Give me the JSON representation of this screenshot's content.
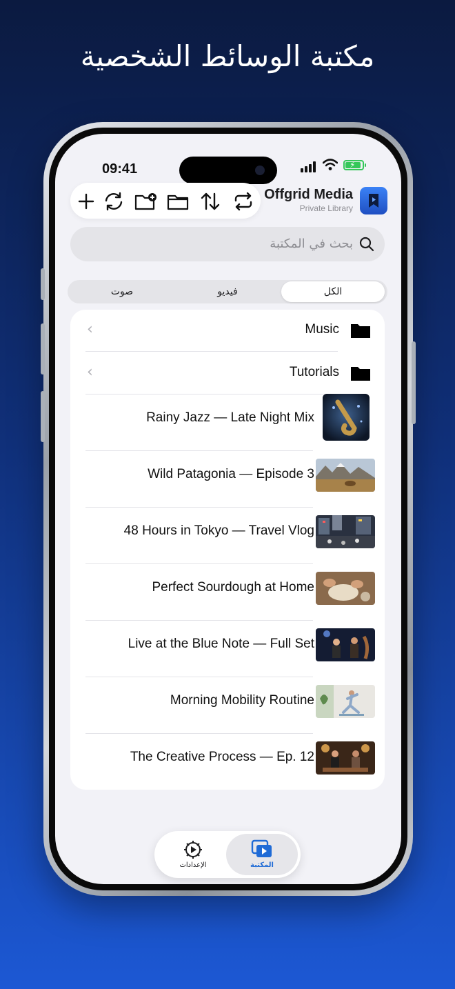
{
  "headline": "مكتبة الوسائط الشخصية",
  "status_bar": {
    "time": "09:41",
    "signal_icon": "signal-icon",
    "wifi_icon": "wifi-icon",
    "battery_icon": "battery-charging-icon"
  },
  "app": {
    "title": "Offgrid Media",
    "subtitle": "Private Library",
    "logo_icon": "bookmark-play-icon"
  },
  "toolbar": {
    "buttons": [
      {
        "icon": "plus-icon"
      },
      {
        "icon": "sync-icon"
      },
      {
        "icon": "new-folder-icon"
      },
      {
        "icon": "folder-icon"
      },
      {
        "icon": "sort-icon"
      },
      {
        "icon": "repeat-icon"
      }
    ]
  },
  "search": {
    "placeholder": "بحث في المكتبة",
    "icon": "search-icon"
  },
  "segments": {
    "all": "الكل",
    "video": "فيديو",
    "audio": "صوت",
    "selected": "الكل"
  },
  "folders": [
    {
      "title": "Music"
    },
    {
      "title": "Tutorials"
    }
  ],
  "media": [
    {
      "title": "Rainy Jazz — Late Night Mix",
      "kind": "audio"
    },
    {
      "title": "Wild Patagonia — Episode 3",
      "kind": "video"
    },
    {
      "title": "48 Hours in Tokyo — Travel Vlog",
      "kind": "video"
    },
    {
      "title": "Perfect Sourdough at Home",
      "kind": "video"
    },
    {
      "title": "Live at the Blue Note — Full Set",
      "kind": "video"
    },
    {
      "title": "Morning Mobility Routine",
      "kind": "video"
    },
    {
      "title": "The Creative Process — Ep. 12",
      "kind": "video"
    }
  ],
  "tabbar": {
    "library": {
      "label": "المكتبة",
      "icon": "library-play-icon",
      "active": true
    },
    "settings": {
      "label": "الإعدادات",
      "icon": "settings-gear-icon",
      "active": false
    }
  },
  "colors": {
    "accent": "#1f6bd6",
    "background_top": "#0b1a40",
    "background_bottom": "#1c58d4"
  }
}
